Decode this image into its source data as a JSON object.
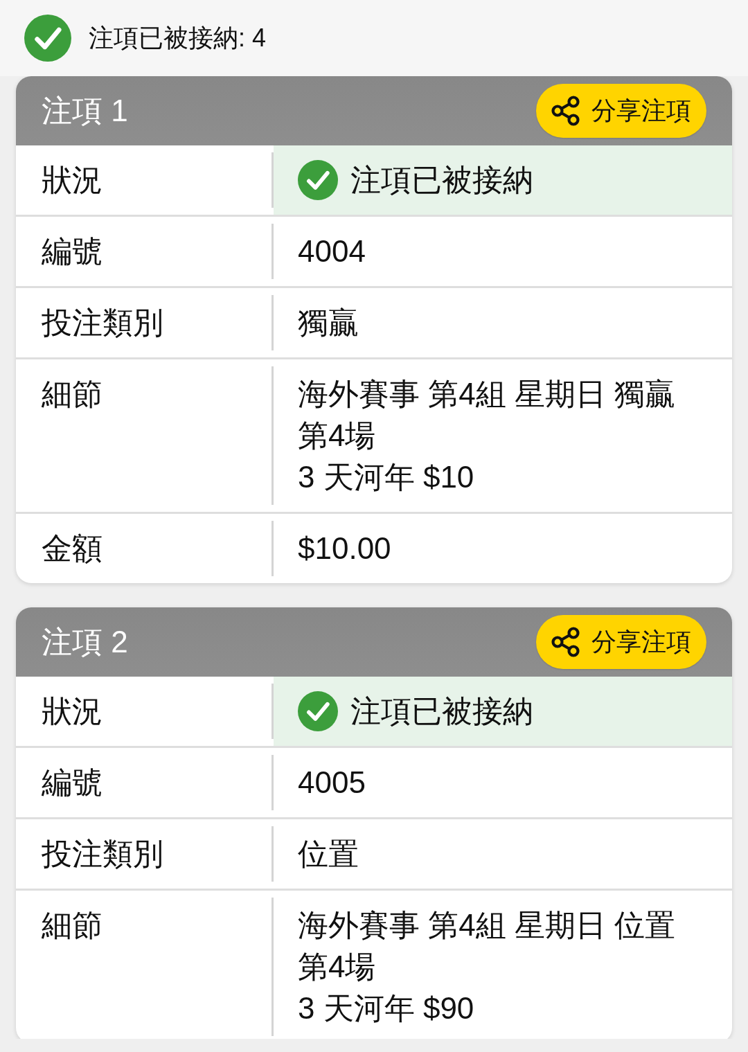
{
  "summary": {
    "accepted": true,
    "text": "注項已被接納: 4"
  },
  "bets": [
    {
      "title": "注項 1",
      "share_button": "分享注項",
      "rows": [
        {
          "kind": "status",
          "label": "狀況",
          "value": "注項已被接納",
          "accepted": true
        },
        {
          "kind": "text",
          "label": "編號",
          "value": "4004"
        },
        {
          "kind": "text",
          "label": "投注類別",
          "value": "獨贏"
        },
        {
          "kind": "lines",
          "label": "細節",
          "lines": [
            "海外賽事 第4組 星期日 獨贏",
            "第4場",
            "3 天河年 $10"
          ]
        },
        {
          "kind": "text",
          "label": "金額",
          "value": "$10.00"
        }
      ]
    },
    {
      "title": "注項 2",
      "share_button": "分享注項",
      "rows": [
        {
          "kind": "status",
          "label": "狀況",
          "value": "注項已被接納",
          "accepted": true
        },
        {
          "kind": "text",
          "label": "編號",
          "value": "4005"
        },
        {
          "kind": "text",
          "label": "投注類別",
          "value": "位置"
        },
        {
          "kind": "lines",
          "label": "細節",
          "lines": [
            "海外賽事 第4組 星期日 位置",
            "第4場",
            "3 天河年 $90"
          ]
        }
      ]
    }
  ]
}
